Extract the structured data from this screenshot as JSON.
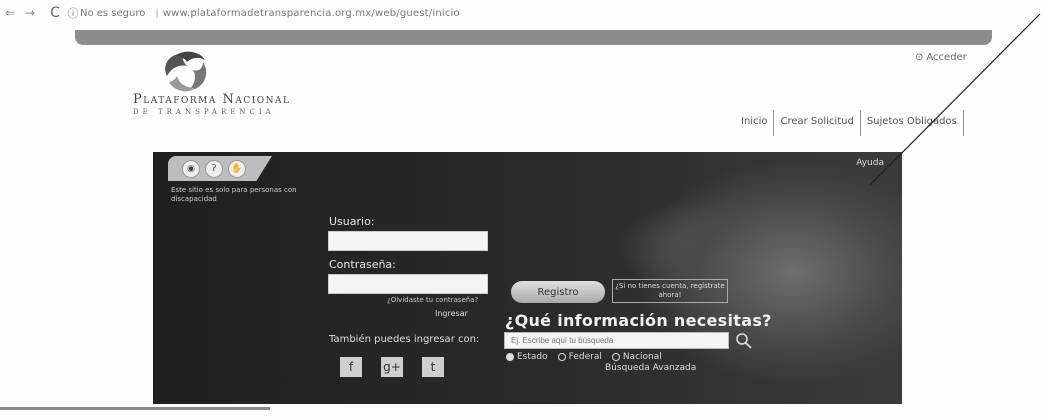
{
  "browser": {
    "back": "⇐",
    "forward": "→",
    "reload": "C",
    "security_icon": "info-icon",
    "security_label": "No es seguro",
    "separator": "|",
    "url": "www.plataformadetransparencia.org.mx/web/guest/inicio"
  },
  "header": {
    "logo_title": "Plataforma Nacional",
    "logo_subtitle": "DE TRANSPARENCIA",
    "acceder": "Acceder",
    "tabs": [
      "Inicio",
      "Crear Solicitud",
      "Sujetos Obligados"
    ]
  },
  "hero": {
    "ayuda": "Ayuda",
    "accessibility_icons": [
      "eye-icon",
      "ear-icon",
      "hand-icon"
    ],
    "accessibility_note": "Este sitio es solo para personas con discapacidad",
    "login": {
      "usuario_label": "Usuario:",
      "contrasena_label": "Contraseña:",
      "olvidaste": "¿Olvidaste tu contraseña?",
      "ingresar": "Ingresar",
      "registro_button": "Registro",
      "no_cuenta": "¿Si no tienes cuenta, regístrate ahora!",
      "tambien": "También puedes ingresar con:",
      "social": [
        "facebook-icon",
        "google-plus-icon",
        "twitter-icon"
      ]
    },
    "search": {
      "question": "¿Qué información necesitas?",
      "placeholder": "Ej. Escribe aquí tu búsqueda",
      "options": [
        "Estado",
        "Federal",
        "Nacional"
      ],
      "selected": "Estado",
      "advanced": "Búsqueda Avanzada"
    }
  }
}
